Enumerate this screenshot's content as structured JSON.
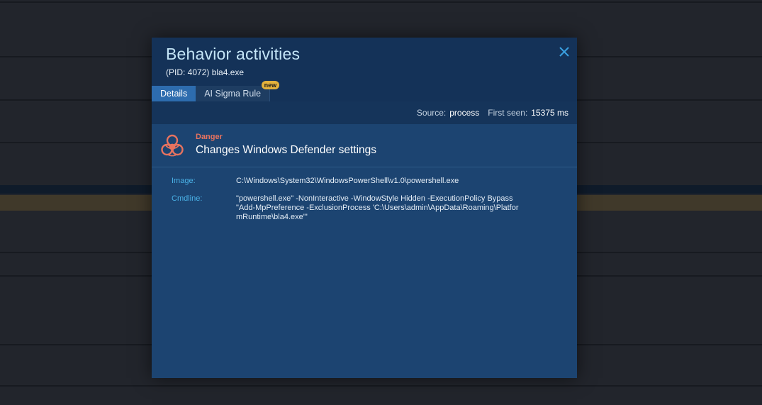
{
  "modal": {
    "title": "Behavior activities",
    "subtitle": "(PID: 4072) bla4.exe",
    "close_icon": "close-icon"
  },
  "tabs": [
    {
      "label": "Details",
      "active": true
    },
    {
      "label": "AI Sigma Rule",
      "active": false,
      "badge": "new"
    }
  ],
  "meta": {
    "source_label": "Source:",
    "source_value": "process",
    "first_seen_label": "First seen:",
    "first_seen_value": "15375 ms"
  },
  "alert": {
    "icon": "biohazard-icon",
    "level": "Danger",
    "title": "Changes Windows Defender settings",
    "level_color": "#e8735f"
  },
  "details": {
    "image_label": "Image:",
    "image_value": "C:\\Windows\\System32\\WindowsPowerShell\\v1.0\\powershell.exe",
    "cmdline_label": "Cmdline:",
    "cmdline_value": "\"powershell.exe\" -NonInteractive -WindowStyle Hidden -ExecutionPolicy Bypass \"Add-MpPreference -ExclusionProcess 'C:\\Users\\admin\\AppData\\Roaming\\PlatformRuntime\\bla4.exe'\""
  },
  "colors": {
    "accent": "#2d6cae",
    "label_blue": "#4ab1e6",
    "badge": "#e3b23c"
  }
}
